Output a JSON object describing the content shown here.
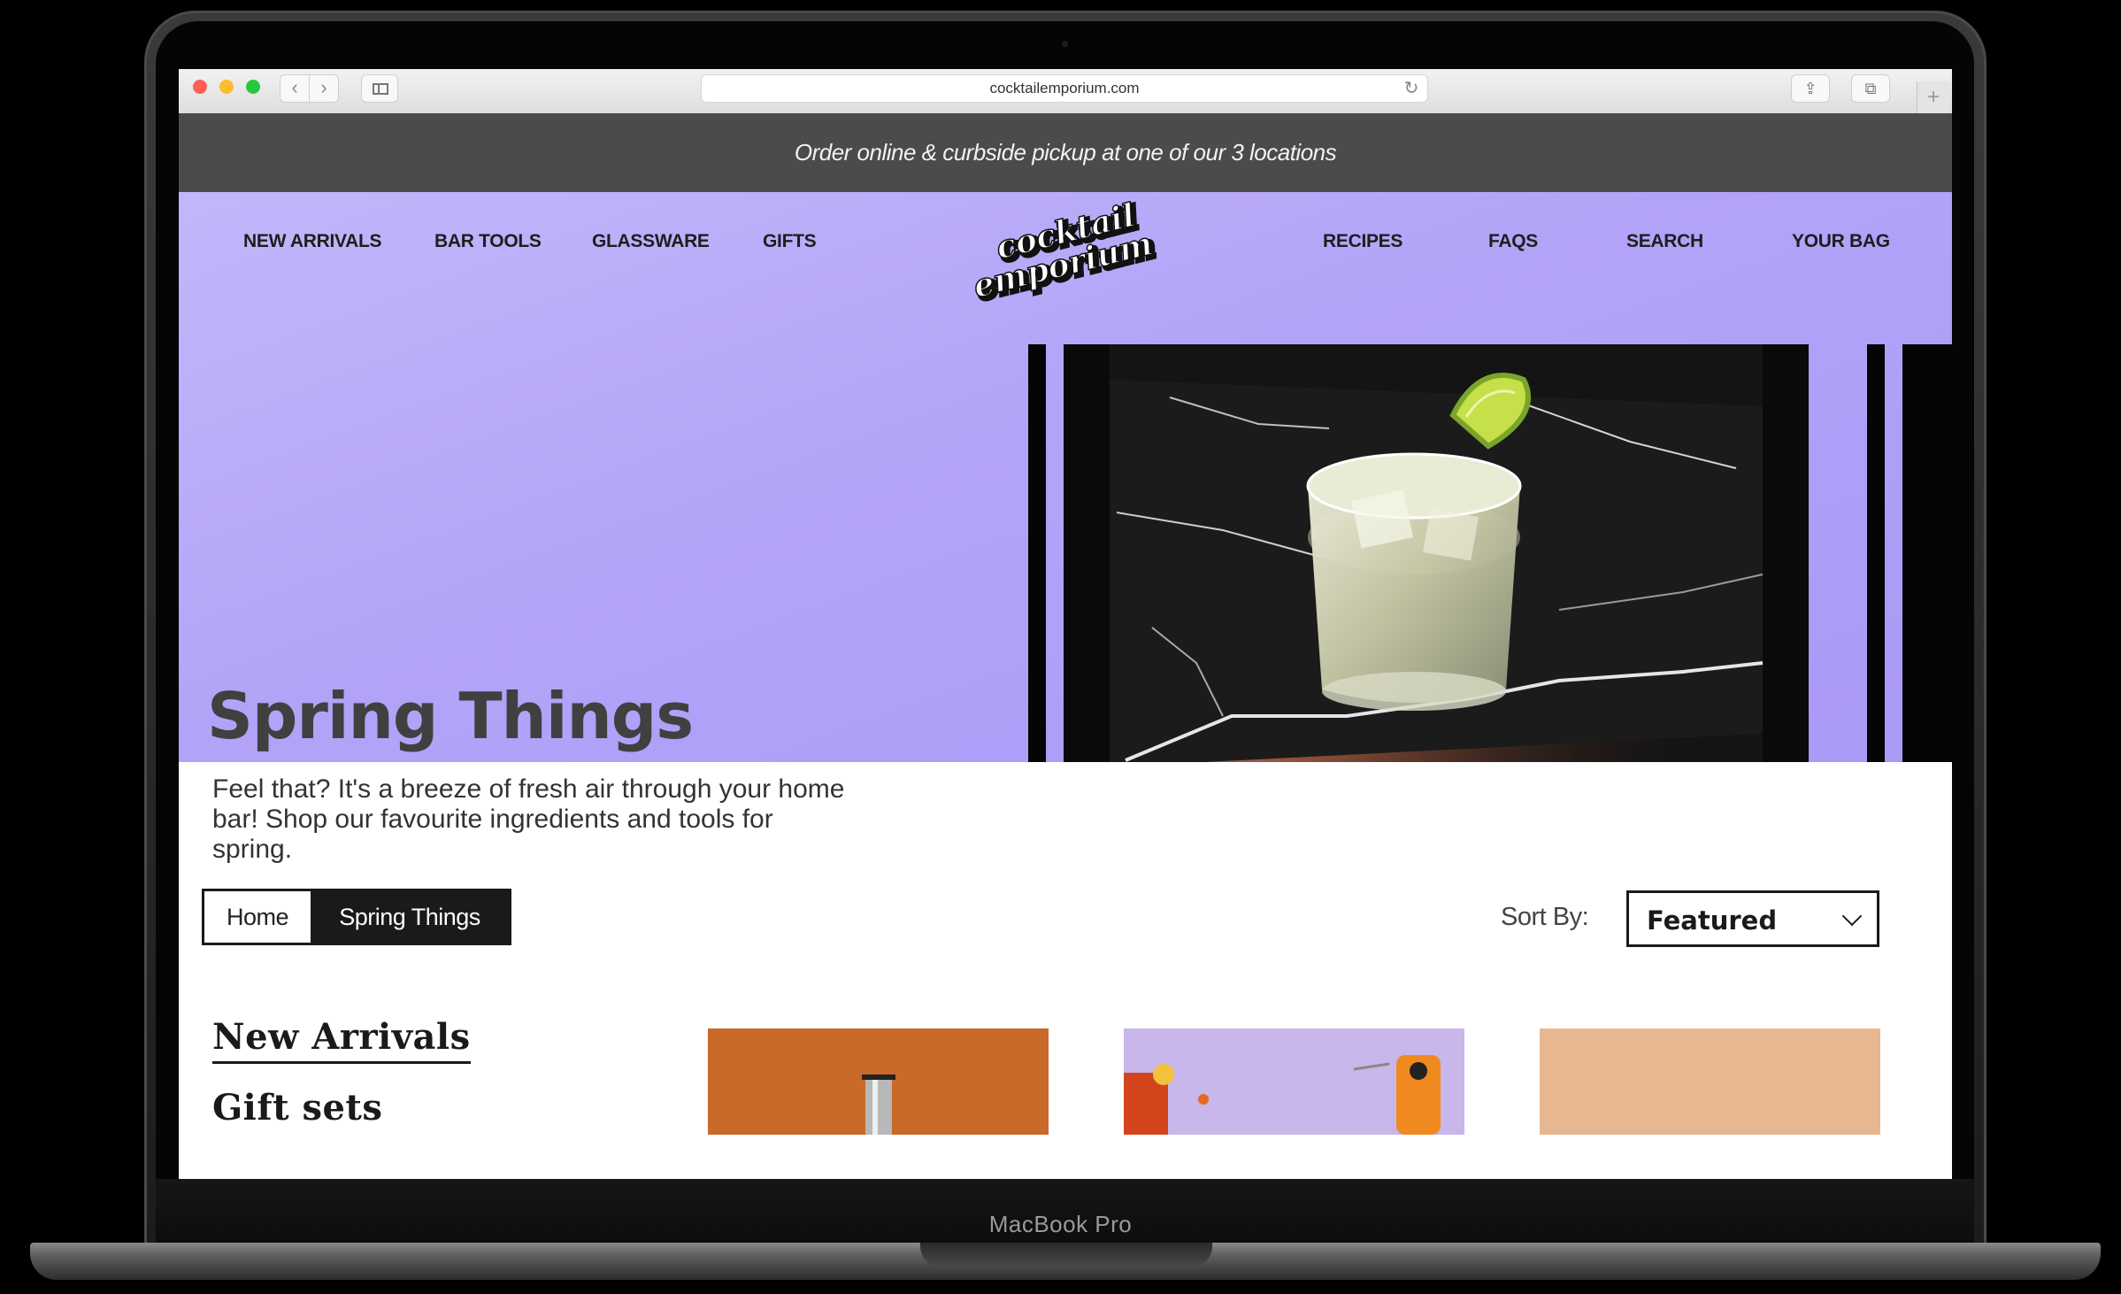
{
  "device": {
    "model_label": "MacBook Pro"
  },
  "browser": {
    "url": "cocktailemporium.com",
    "back_icon": "‹",
    "forward_icon": "›",
    "reload_icon": "↻",
    "share_icon": "⇪",
    "tabs_icon": "⧉",
    "new_tab_icon": "+"
  },
  "announcement": {
    "text": "Order online & curbside pickup at one of our 3 locations"
  },
  "nav": {
    "left": [
      "NEW ARRIVALS",
      "BAR TOOLS",
      "GLASSWARE",
      "GIFTS"
    ],
    "right": [
      "RECIPES",
      "FAQS",
      "SEARCH",
      "YOUR BAG"
    ],
    "logo": {
      "line1": "cocktail",
      "line2": "emporium"
    }
  },
  "hero": {
    "title": "Spring Things",
    "subtitle": "Feel that? It's a breeze of fresh air through your home bar! Shop our favourite ingredients and tools for spring."
  },
  "breadcrumb": {
    "home": "Home",
    "current": "Spring Things"
  },
  "sort": {
    "label": "Sort By:",
    "value": "Featured"
  },
  "filters": {
    "active": "New Arrivals",
    "next": "Gift sets"
  },
  "colors": {
    "hero_lavender": "#b3a3f8",
    "announcement_bg": "#4b4b4b",
    "ink": "#1a1a1a"
  }
}
